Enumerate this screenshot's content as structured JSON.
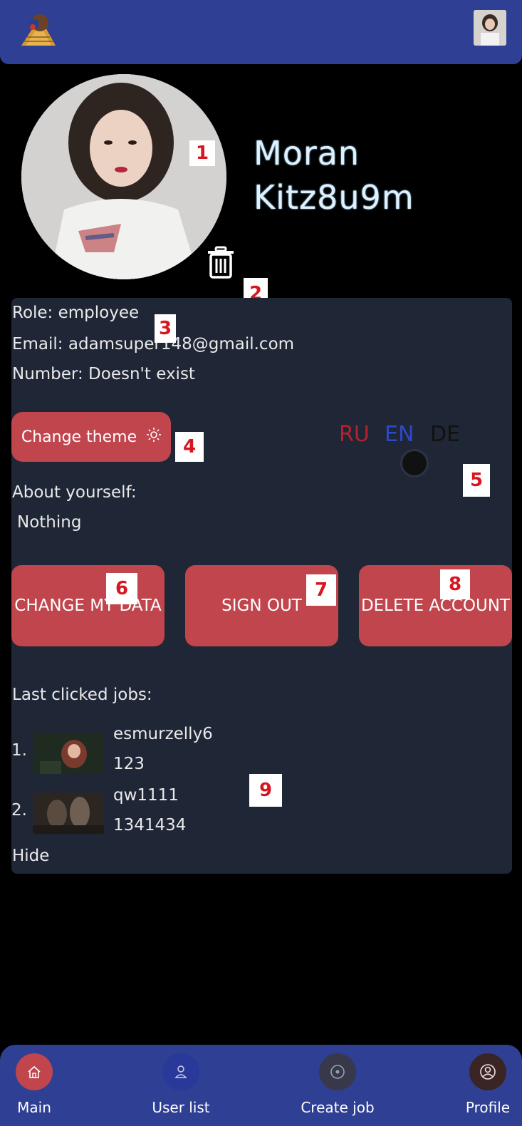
{
  "header": {
    "logo_icon": "mole-logo-icon",
    "avatar_icon": "user-avatar-thumbnail"
  },
  "profile": {
    "first_name": "Moran",
    "last_name": "Kitz8u9m",
    "delete_photo_icon": "trash-icon"
  },
  "info": {
    "role": "Role: employee",
    "email": "Email: adamsuper148@gmail.com",
    "number": "Number: Doesn't exist",
    "about_label": "About yourself:",
    "about_value": "Nothing"
  },
  "theme_button": {
    "label": "Change theme",
    "icon": "sun-icon"
  },
  "languages": [
    {
      "code": "RU",
      "color": "#b1232f"
    },
    {
      "code": "EN",
      "color": "#2e49c8"
    },
    {
      "code": "DE",
      "color": "#111111"
    }
  ],
  "actions": {
    "change_data": "CHANGE MY DATA",
    "sign_out": "SIGN OUT",
    "delete_account": "DELETE ACCOUNT"
  },
  "jobs": {
    "label": "Last clicked jobs:",
    "items": [
      {
        "num": "1.",
        "title": "esmurzelly6",
        "value": "123"
      },
      {
        "num": "2.",
        "title": "qw1111",
        "value": "1341434"
      }
    ],
    "hide_label": "Hide"
  },
  "badges": [
    "1",
    "2",
    "3",
    "4",
    "5",
    "6",
    "7",
    "8",
    "9"
  ],
  "nav": [
    {
      "label": "Main",
      "icon": "home-icon"
    },
    {
      "label": "User list",
      "icon": "user-icon"
    },
    {
      "label": "Create job",
      "icon": "create-icon"
    },
    {
      "label": "Profile",
      "icon": "profile-icon"
    }
  ],
  "colors": {
    "header_bg": "#2f3f93",
    "card_bg": "#1f2636",
    "accent_button": "#c0454d",
    "page_bg": "#000000"
  }
}
